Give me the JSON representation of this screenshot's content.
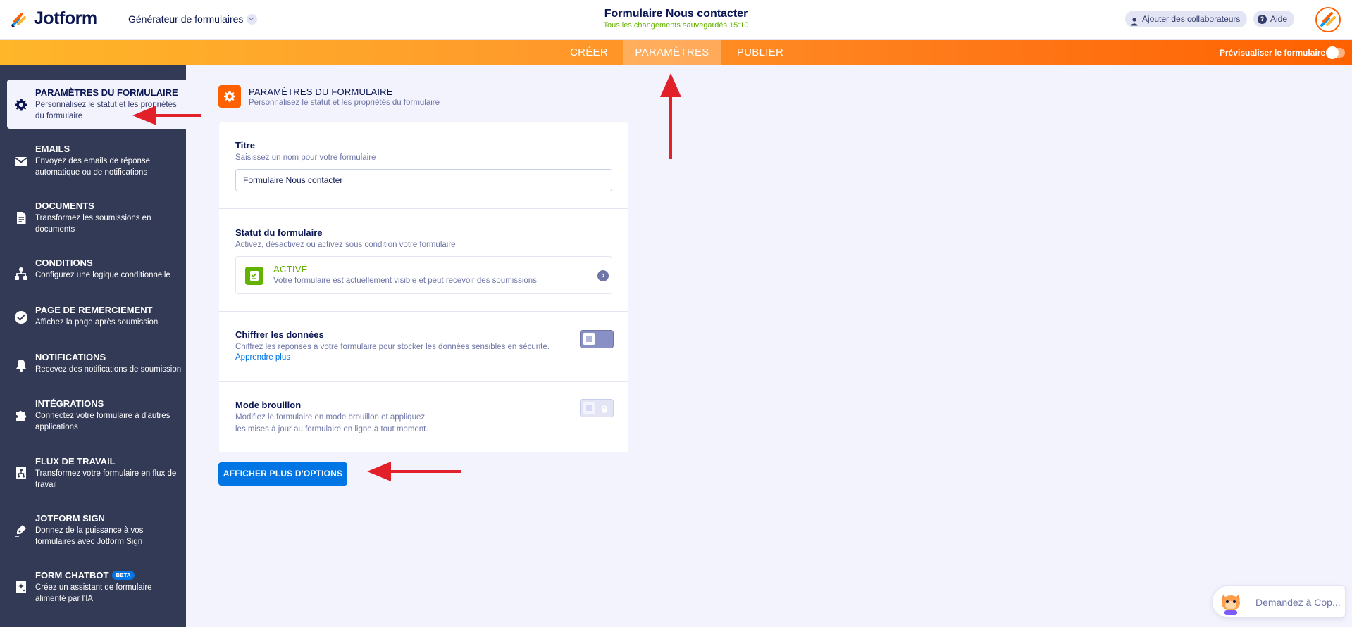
{
  "header": {
    "brand": "Jotform",
    "builder_label": "Générateur de formulaires",
    "form_title": "Formulaire Nous contacter",
    "save_status": "Tous les changements sauvegardés 15:10",
    "collaborators_label": "Ajouter des collaborateurs",
    "help_label": "Aide"
  },
  "nav": {
    "tabs": [
      {
        "label": "CRÉER",
        "active": false
      },
      {
        "label": "PARAMÈTRES",
        "active": true
      },
      {
        "label": "PUBLIER",
        "active": false
      }
    ],
    "preview_label": "Prévisualiser le formulaire"
  },
  "sidebar": {
    "items": [
      {
        "title": "PARAMÈTRES DU FORMULAIRE",
        "desc": "Personnalisez le statut et les propriétés du formulaire",
        "icon": "gear-icon",
        "active": true
      },
      {
        "title": "EMAILS",
        "desc": "Envoyez des emails de réponse automatique ou de notifications",
        "icon": "envelope-icon"
      },
      {
        "title": "DOCUMENTS",
        "desc": "Transformez les soumissions en documents",
        "icon": "document-icon"
      },
      {
        "title": "CONDITIONS",
        "desc": "Configurez une logique conditionnelle",
        "icon": "hierarchy-icon"
      },
      {
        "title": "PAGE DE REMERCIEMENT",
        "desc": "Affichez la page après soumission",
        "icon": "check-circle-icon"
      },
      {
        "title": "NOTIFICATIONS",
        "desc": "Recevez des notifications de soumission",
        "icon": "bell-icon"
      },
      {
        "title": "INTÉGRATIONS",
        "desc": "Connectez votre formulaire à d'autres applications",
        "icon": "puzzle-icon"
      },
      {
        "title": "FLUX DE TRAVAIL",
        "desc": "Transformez votre formulaire en flux de travail",
        "icon": "workflow-icon"
      },
      {
        "title": "JOTFORM SIGN",
        "desc": "Donnez de la puissance à vos formulaires avec Jotform Sign",
        "icon": "pen-icon"
      },
      {
        "title": "FORM CHATBOT",
        "badge": "BETA",
        "desc": "Créez un assistant de formulaire alimenté par l'IA",
        "icon": "chatbot-icon"
      }
    ]
  },
  "main": {
    "section_title": "PARAMÈTRES DU FORMULAIRE",
    "section_subtitle": "Personnalisez le statut et les propriétés du formulaire",
    "title_field": {
      "label": "Titre",
      "hint": "Saisissez un nom pour votre formulaire",
      "value": "Formulaire Nous contacter"
    },
    "status": {
      "label": "Statut du formulaire",
      "hint": "Activez, désactivez ou activez sous condition votre formulaire",
      "value": "ACTIVÉ",
      "value_desc": "Votre formulaire est actuellement visible et peut recevoir des soumissions"
    },
    "encrypt": {
      "label": "Chiffrer les données",
      "hint": "Chiffrez les réponses à votre formulaire pour stocker les données sensibles en sécurité.",
      "link": "Apprendre plus"
    },
    "draft": {
      "label": "Mode brouillon",
      "hint_line1": "Modifiez le formulaire en mode brouillon et appliquez",
      "hint_line2": "les mises à jour au formulaire en ligne à tout moment."
    },
    "more_options_label": "AFFICHER PLUS D'OPTIONS"
  },
  "copilot": {
    "label": "Demandez à Cop..."
  },
  "colors": {
    "accent_orange": "#ff6100",
    "sidebar_bg": "#333a55",
    "primary_blue": "#0075e3",
    "status_green": "#64b200"
  }
}
